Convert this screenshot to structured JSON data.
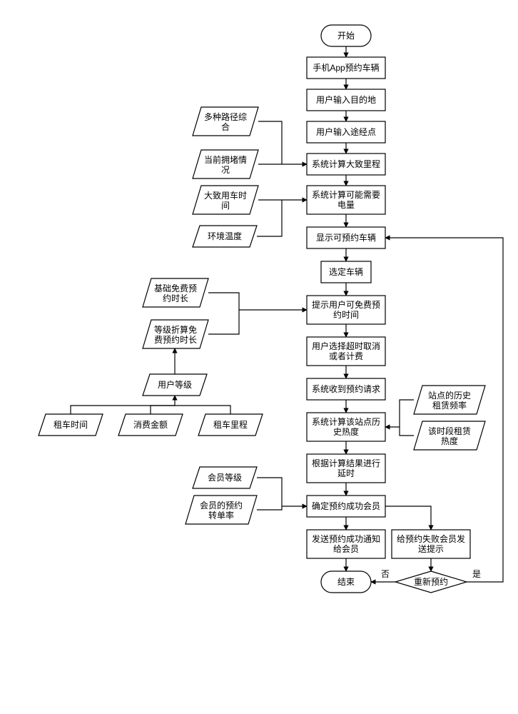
{
  "terminator": {
    "start": "开始",
    "end": "结束"
  },
  "process": {
    "p1": "手机App预约车辆",
    "p2": "用户输入目的地",
    "p3": "用户输入途经点",
    "p4": "系统计算大致里程",
    "p5_l1": "系统计算可能需要",
    "p5_l2": "电量",
    "p6": "显示可预约车辆",
    "p7": "选定车辆",
    "p8_l1": "提示用户可免费预",
    "p8_l2": "约时间",
    "p9_l1": "用户选择超时取消",
    "p9_l2": "或者计费",
    "p10": "系统收到预约请求",
    "p11_l1": "系统计算该站点历",
    "p11_l2": "史热度",
    "p12_l1": "根据计算结果进行",
    "p12_l2": "延时",
    "p13": "确定预约成功会员",
    "p14_l1": "发送预约成功通知",
    "p14_l2": "给会员",
    "p15_l1": "给预约失败会员发",
    "p15_l2": "送提示"
  },
  "input": {
    "i1_l1": "多种路径综",
    "i1_l2": "合",
    "i2_l1": "当前拥堵情",
    "i2_l2": "况",
    "i3_l1": "大致用车时",
    "i3_l2": "间",
    "i4": "环境温度",
    "i5_l1": "基础免费预",
    "i5_l2": "约时长",
    "i6_l1": "等级折算免",
    "i6_l2": "费预约时长",
    "i7": "用户等级",
    "i8": "租车时间",
    "i9": "消费金额",
    "i10": "租车里程",
    "i11": "会员等级",
    "i12_l1": "会员的预约",
    "i12_l2": "转单率",
    "i13_l1": "站点的历史",
    "i13_l2": "租赁频率",
    "i14_l1": "该时段租赁",
    "i14_l2": "热度"
  },
  "decision": {
    "d1": "重新预约"
  },
  "labels": {
    "no": "否",
    "yes": "是"
  }
}
